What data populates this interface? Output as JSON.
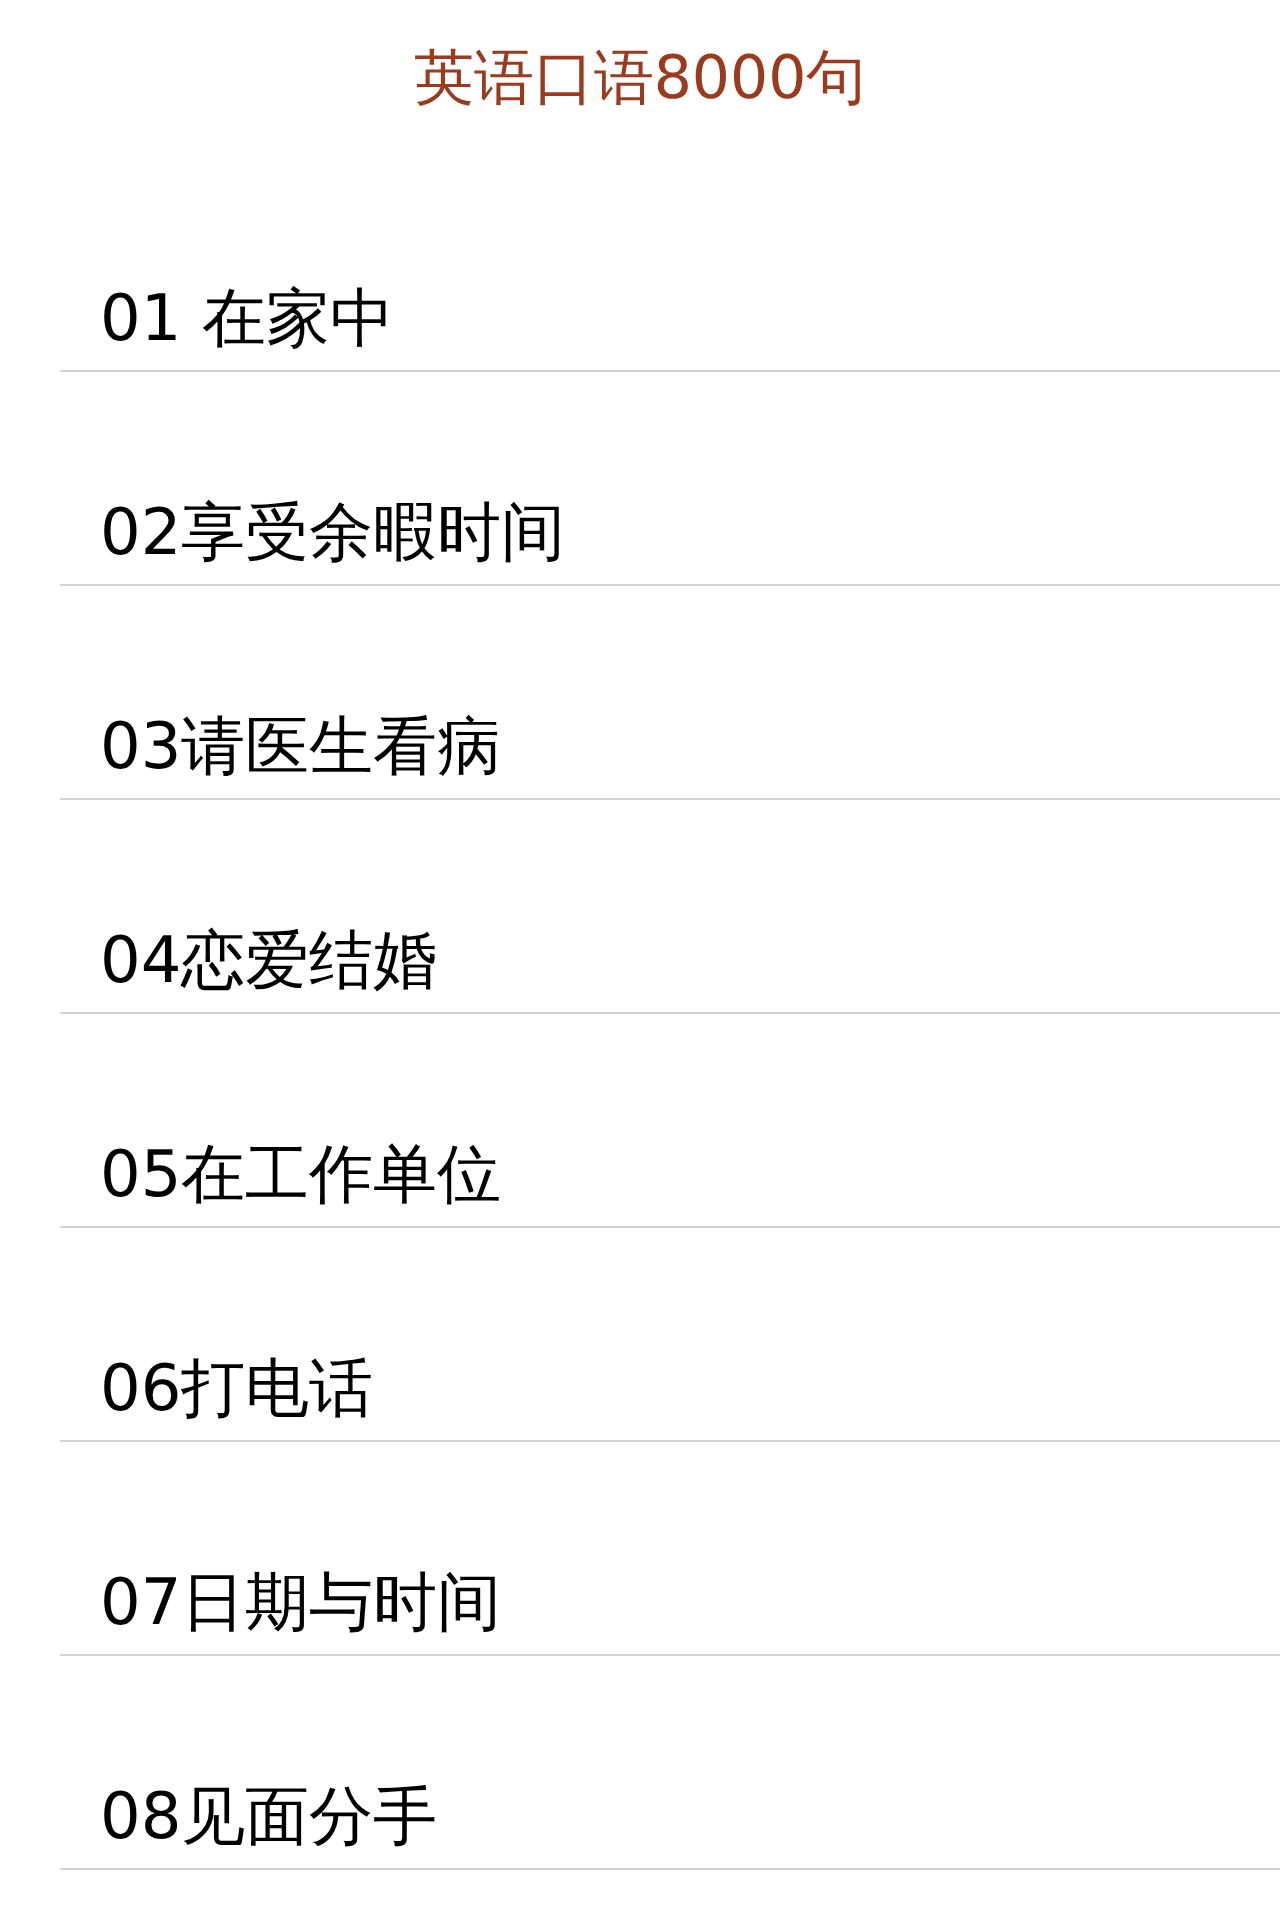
{
  "title": "英语口语8000句",
  "items": [
    {
      "label": "01 在家中"
    },
    {
      "label": "02享受余暇时间"
    },
    {
      "label": "03请医生看病"
    },
    {
      "label": "04恋爱结婚"
    },
    {
      "label": "05在工作单位"
    },
    {
      "label": "06打电话"
    },
    {
      "label": "07日期与时间"
    },
    {
      "label": "08见面分手"
    }
  ]
}
